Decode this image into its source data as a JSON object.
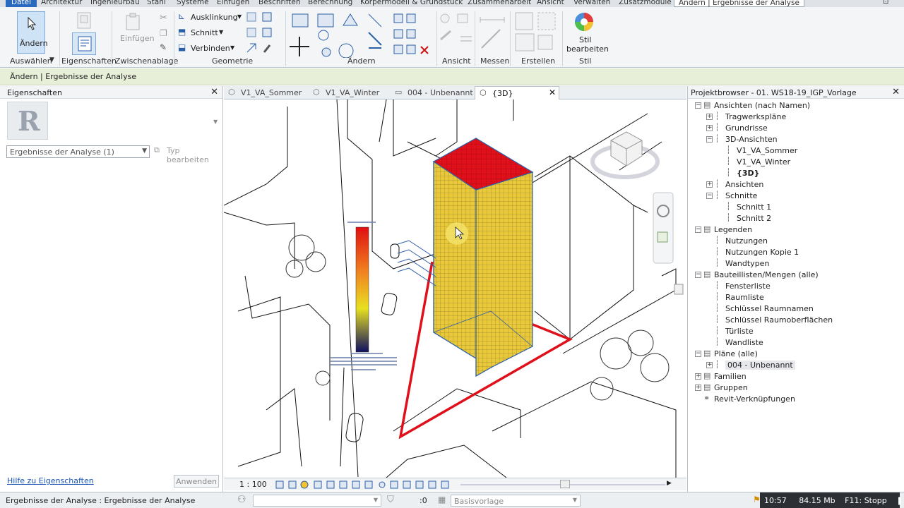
{
  "menu": {
    "tabs": [
      "Datei",
      "Architektur",
      "Ingenieurbau",
      "Stahl",
      "Systeme",
      "Einfügen",
      "Beschriften",
      "Berechnung",
      "Körpermodell & Grundstück",
      "Zusammenarbeit",
      "Ansicht",
      "Verwalten",
      "Zusatzmodule",
      "Ändern | Ergebnisse der Analyse"
    ]
  },
  "ribbon": {
    "aendern": "Ändern",
    "eigenschaften": "Eigenschaften",
    "einfuegen": "Einfügen",
    "ausklinkung": "Ausklinkung",
    "schnitt": "Schnitt",
    "verbinden": "Verbinden",
    "stil_bearbeiten_1": "Stil",
    "stil_bearbeiten_2": "bearbeiten",
    "panels": [
      "Auswählen",
      "Eigenschaften",
      "Zwischenablage",
      "Geometrie",
      "Ändern",
      "Ansicht",
      "Messen",
      "Erstellen",
      "Stil"
    ]
  },
  "options_bar": "Ändern | Ergebnisse der Analyse",
  "properties": {
    "title": "Eigenschaften",
    "type_selector": "Ergebnisse der Analyse (1)",
    "edit_type": "Typ bearbeiten",
    "help_link": "Hilfe zu Eigenschaften",
    "apply": "Anwenden"
  },
  "view_tabs": [
    {
      "label": "V1_VA_Sommer",
      "active": false
    },
    {
      "label": "V1_VA_Winter",
      "active": false
    },
    {
      "label": "004 - Unbenannt",
      "active": false
    },
    {
      "label": "{3D}",
      "active": true
    }
  ],
  "view_bar": {
    "scale": "1 : 100"
  },
  "browser": {
    "title": "Projektbrowser - 01. WS18-19_IGP_Vorlage",
    "items": [
      {
        "label": "Ansichten (nach Namen)",
        "level": 0,
        "exp": "−"
      },
      {
        "label": "Tragwerkspläne",
        "level": 1,
        "exp": "+"
      },
      {
        "label": "Grundrisse",
        "level": 1,
        "exp": "+"
      },
      {
        "label": "3D-Ansichten",
        "level": 1,
        "exp": "−"
      },
      {
        "label": "V1_VA_Sommer",
        "level": 2,
        "exp": ""
      },
      {
        "label": "V1_VA_Winter",
        "level": 2,
        "exp": ""
      },
      {
        "label": "{3D}",
        "level": 2,
        "exp": "",
        "bold": true
      },
      {
        "label": "Ansichten",
        "level": 1,
        "exp": "+"
      },
      {
        "label": "Schnitte",
        "level": 1,
        "exp": "−"
      },
      {
        "label": "Schnitt 1",
        "level": 2,
        "exp": ""
      },
      {
        "label": "Schnitt 2",
        "level": 2,
        "exp": ""
      },
      {
        "label": "Legenden",
        "level": 0,
        "exp": "−"
      },
      {
        "label": "Nutzungen",
        "level": 1,
        "exp": ""
      },
      {
        "label": "Nutzungen Kopie 1",
        "level": 1,
        "exp": ""
      },
      {
        "label": "Wandtypen",
        "level": 1,
        "exp": ""
      },
      {
        "label": "Bauteillisten/Mengen (alle)",
        "level": 0,
        "exp": "−"
      },
      {
        "label": "Fensterliste",
        "level": 1,
        "exp": ""
      },
      {
        "label": "Raumliste",
        "level": 1,
        "exp": ""
      },
      {
        "label": "Schlüssel Raumnamen",
        "level": 1,
        "exp": ""
      },
      {
        "label": "Schlüssel Raumoberflächen",
        "level": 1,
        "exp": ""
      },
      {
        "label": "Türliste",
        "level": 1,
        "exp": ""
      },
      {
        "label": "Wandliste",
        "level": 1,
        "exp": ""
      },
      {
        "label": "Pläne (alle)",
        "level": 0,
        "exp": "−"
      },
      {
        "label": "004 - Unbenannt",
        "level": 1,
        "exp": "+",
        "highlight": true
      },
      {
        "label": "Familien",
        "level": 0,
        "exp": "+"
      },
      {
        "label": "Gruppen",
        "level": 0,
        "exp": "+"
      },
      {
        "label": "Revit-Verknüpfungen",
        "level": 0,
        "exp": ""
      }
    ]
  },
  "status": {
    "text": "Ergebnisse der Analyse : Ergebnisse der Analyse",
    "zero": ":0",
    "template": "Basisvorlage",
    "time": "10:57",
    "memory": "84.15 Mb",
    "f11": "F11: Stopp"
  },
  "colors": {
    "accent": "#2a6bbf",
    "analysis_red": "#e0101a",
    "analysis_yellow": "#e6c22a",
    "selection": "#2b5fa8"
  }
}
